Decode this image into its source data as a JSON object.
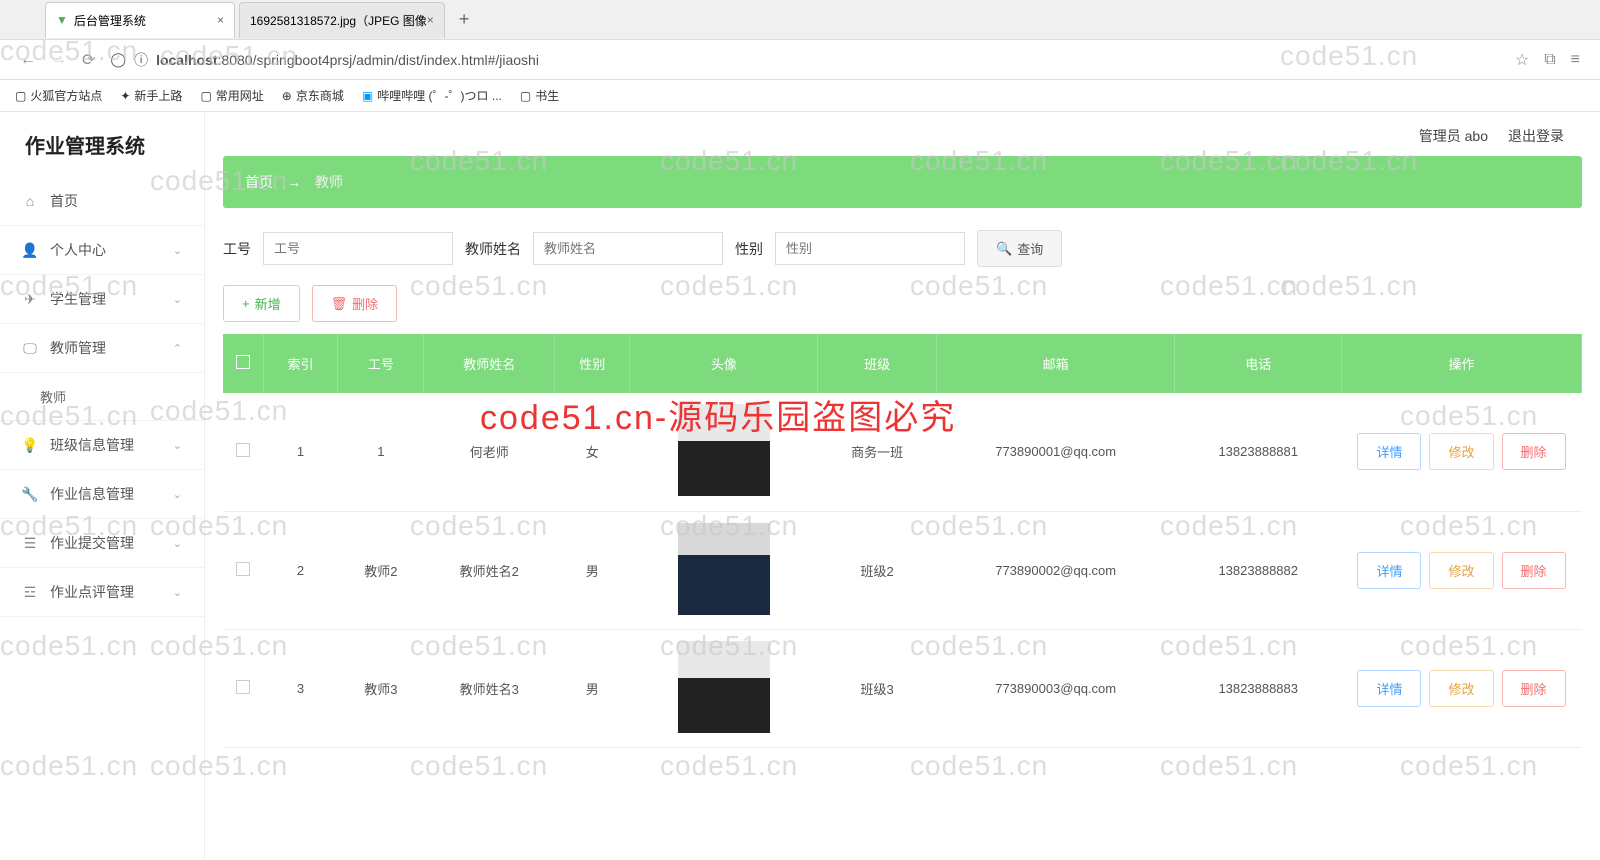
{
  "browser": {
    "tab1": "后台管理系统",
    "tab2": "1692581318572.jpg（JPEG 图像",
    "url_prefix": "localhost",
    "url_rest": ":8080/springboot4prsj/admin/dist/index.html#/jiaoshi",
    "bookmarks": [
      "火狐官方站点",
      "新手上路",
      "常用网址",
      "京东商城",
      "哔哩哔哩 (゜-゜)つロ ...",
      "书生"
    ]
  },
  "app": {
    "title": "作业管理系统",
    "user": "管理员 abo",
    "logout": "退出登录"
  },
  "sidebar": {
    "items": [
      {
        "label": "首页",
        "icon": "home"
      },
      {
        "label": "个人中心",
        "icon": "user",
        "chev": true
      },
      {
        "label": "学生管理",
        "icon": "send",
        "chev": true
      },
      {
        "label": "教师管理",
        "icon": "monitor",
        "chev": true,
        "expanded": true
      },
      {
        "label": "教师",
        "sub": true
      },
      {
        "label": "班级信息管理",
        "icon": "bulb",
        "chev": true
      },
      {
        "label": "作业信息管理",
        "icon": "wrench",
        "chev": true
      },
      {
        "label": "作业提交管理",
        "icon": "layers",
        "chev": true
      },
      {
        "label": "作业点评管理",
        "icon": "list",
        "chev": true
      }
    ]
  },
  "breadcrumb": {
    "home": "首页",
    "arrow": "→",
    "current": "教师"
  },
  "search": {
    "f1_label": "工号",
    "f1_ph": "工号",
    "f2_label": "教师姓名",
    "f2_ph": "教师姓名",
    "f3_label": "性别",
    "f3_ph": "性别",
    "query": "查询"
  },
  "actions": {
    "add": "新增",
    "delete": "删除"
  },
  "table": {
    "headers": [
      "",
      "索引",
      "工号",
      "教师姓名",
      "性别",
      "头像",
      "班级",
      "邮箱",
      "电话",
      "操作"
    ],
    "rows": [
      {
        "idx": "1",
        "code": "1",
        "name": "何老师",
        "gender": "女",
        "av": "f",
        "cls": "商务一班",
        "email": "773890001@qq.com",
        "phone": "13823888881"
      },
      {
        "idx": "2",
        "code": "教师2",
        "name": "教师姓名2",
        "gender": "男",
        "av": "m",
        "cls": "班级2",
        "email": "773890002@qq.com",
        "phone": "13823888882"
      },
      {
        "idx": "3",
        "code": "教师3",
        "name": "教师姓名3",
        "gender": "男",
        "av": "f",
        "cls": "班级3",
        "email": "773890003@qq.com",
        "phone": "13823888883"
      }
    ],
    "ops": {
      "detail": "详情",
      "edit": "修改",
      "delete": "删除"
    }
  },
  "watermark": "code51.cn",
  "watermark_red": "code51.cn-源码乐园盗图必究"
}
